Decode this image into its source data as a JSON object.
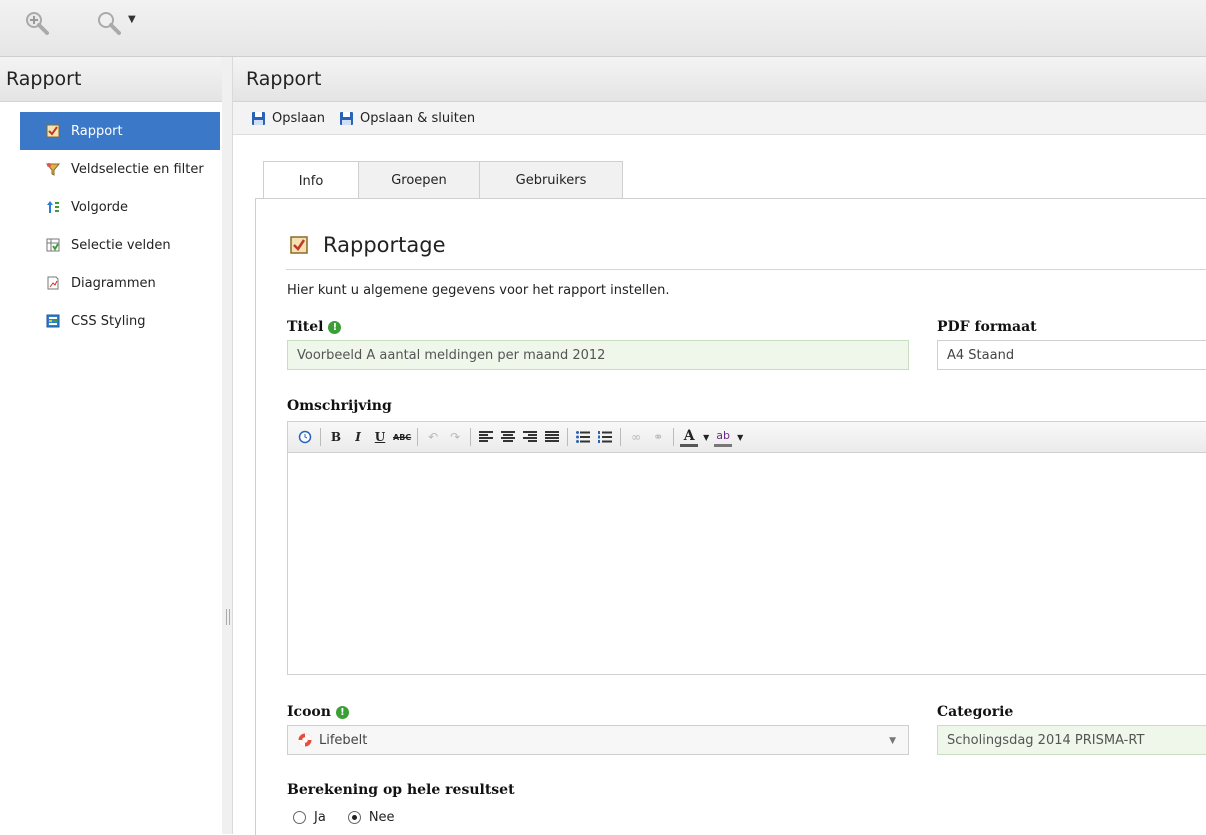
{
  "sidebar": {
    "title": "Rapport",
    "items": [
      {
        "label": "Rapport",
        "icon": "report-check-icon",
        "active": true
      },
      {
        "label": "Veldselectie en filter",
        "icon": "filter-icon"
      },
      {
        "label": "Volgorde",
        "icon": "sort-order-icon"
      },
      {
        "label": "Selectie velden",
        "icon": "field-selection-icon"
      },
      {
        "label": "Diagrammen",
        "icon": "chart-document-icon"
      },
      {
        "label": "CSS Styling",
        "icon": "css-styling-icon"
      }
    ]
  },
  "main": {
    "title": "Rapport",
    "actions": {
      "save": "Opslaan",
      "save_close": "Opslaan & sluiten"
    },
    "tabs": [
      {
        "label": "Info",
        "active": true
      },
      {
        "label": "Groepen"
      },
      {
        "label": "Gebruikers"
      }
    ]
  },
  "form": {
    "section_title": "Rapportage",
    "intro": "Hier kunt u algemene gegevens voor het rapport instellen.",
    "titel_label": "Titel",
    "titel_value": "Voorbeeld A  aantal meldingen per maand 2012",
    "pdf_label": "PDF formaat",
    "pdf_value": "A4 Staand",
    "omschrijving_label": "Omschrijving",
    "icoon_label": "Icoon",
    "icoon_value": "Lifebelt",
    "categorie_label": "Categorie",
    "categorie_value": "Scholingsdag 2014 PRISMA-RT",
    "berekening_label": "Berekening op hele resultset",
    "radio_ja": "Ja",
    "radio_nee": "Nee",
    "radio_selected": "Nee",
    "required_mark": "!"
  },
  "editor_toolbar": {
    "bold": "B",
    "italic": "I",
    "underline": "U",
    "strike": "ABC",
    "font_color": "A",
    "highlight": "ab"
  },
  "colors": {
    "accent": "#3b78c8",
    "required": "#3aa035",
    "field_green": "#eef7ea"
  }
}
